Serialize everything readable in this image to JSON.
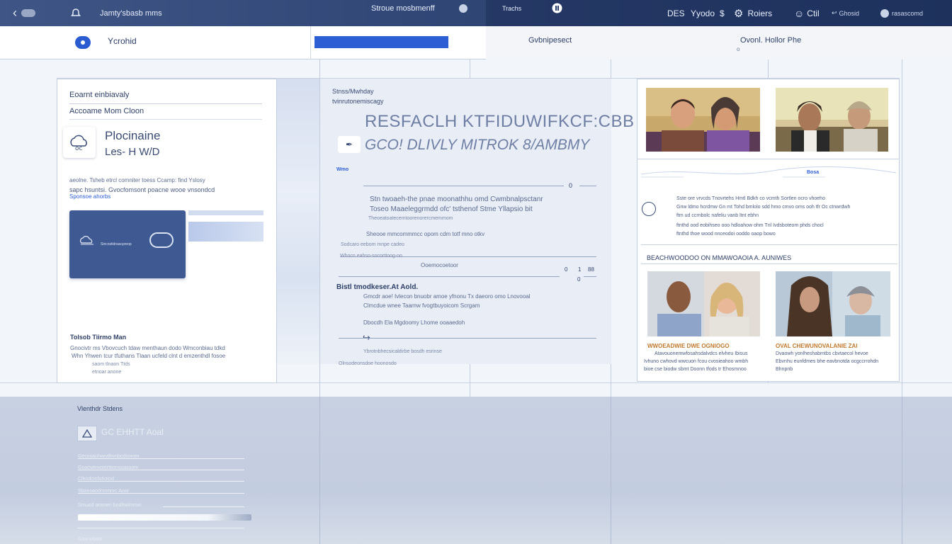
{
  "topbar": {
    "back_label": "",
    "app_title": "Jamty'sbasb mms",
    "center_title": "Stroue mosbmenff",
    "tab_text": "Trachs",
    "right_items": [
      "DES",
      "Yyodo",
      "Roiers",
      "Ctil",
      "Ghosid",
      "rasascomd"
    ]
  },
  "subbar": {
    "left_label": "Ycrohid",
    "mid_label": "Gvbnipesect",
    "right_label": "Ovonl. Hollor Phe",
    "right_sub": "o"
  },
  "panel1": {
    "heading": "Eoarnt einbiavaly",
    "subheading": "Accoame Mom Cloon",
    "icon_title_1": "Plocinaine",
    "icon_title_2": "Les-  H  W/D",
    "para": [
      "aeolne. Tsheb etrcl comniter toess Ccamp: find Yslosy",
      "sapc hsuntsi. Gvocfomsont poacne wooe vnsondcd"
    ],
    "link": "Sponsoe ahorbs",
    "card_label": "Sincostidnascpreop",
    "section_title": "Tolsob Tiirmo Man",
    "section_para": [
      "Gnocivtr ms Vbovcuch tdaw menthaun dodo Wmconbiau tdkd",
      "Whn  Yhwen tcur tfuthans  Tlaan  ucfeld clnt d emzenthdl fosoe",
      "saom tlnaon Ttds",
      "etnoar anone"
    ]
  },
  "middle": {
    "small_title_1": "Stnss/Mwhday",
    "small_title_2": "tvinrutonemiscagy",
    "headline_1": "RESFACLH KTFIDUWIFKCF:CBB",
    "headline_2": "GCO! DLIVLY MITROK 8/AMBMY",
    "tag": "Wmo",
    "rows": [
      {
        "text": "Stn  twoaeh-the  pnae   moonathhu omd  Cwmbnalpsctanr",
        "value": "0"
      },
      {
        "text": "Toseo Maaeleggrmdd  ofc' tsthenof  Stme  Yllapsio  bit",
        "value": ""
      },
      {
        "text": "Theoeatoatecemtoorenorercmemmom",
        "value": ""
      }
    ],
    "row_small": "Sheooe mmcommmcc opom cdm totf mno otkv",
    "row_small_2": "Sodcaro eebom mnpe cadeo",
    "row_small_3": "Whocn eahso-socorttoog-no",
    "row_value": "Ooemocoetoor",
    "row_nums": [
      "0",
      "1",
      "88",
      "0"
    ],
    "section_head": "Bistl tmodkeser.At Aold.",
    "section_lines": [
      "Gmcdr aoe! Ivlecon bnuobr amoe yfnonu Tx daeoro omo Lnovooal",
      "Clmcdue wnee Taarnw fvogtbuyoicom Scrgam",
      "Dbocdh Ela Mgdoomy Lhome ooaaedoh"
    ],
    "footer_1": "Ybrotnbhecsicaldirbe bosdh esrinse",
    "footer_2": "Olnsodeonsdoe hoonosdo"
  },
  "right": {
    "people_1_alt": "two men",
    "people_2_alt": "two men outdoors",
    "tag": "Bosa",
    "info_lines": [
      "Sste  ore  vrvcds Tnovrtehs Hmtl Bdkh co vcmth  Sortlen ocro  vhoeho",
      "Gnw ldmo hcrdmw Gn mt Tohd bmlolo sdd hmo cmvo oms ooh  tfr Oc  ctnwrdwh",
      "ftm ud ccrnbolc  nafeliu vanb ltnt  ebhn",
      "ftnthd ood eobihseo ooo hdloahow ohm Tnl Ivdsboteom phds  chocl",
      "ftnthd thoe wood nnceodoi ooddo oaop bowo"
    ],
    "section_head": "BEACHWOODOO ON MMAWOAOIA A. AUNIWES",
    "caption_1_title": "WWOEADWIE DWE OGNIOGO",
    "caption_1_lines": [
      "Atavouonemwfosahsdalvdcs elvheu Ibisus",
      "Ivhuno cwhovd wwcuon fcou cvosieahoo wmbh",
      "bioe cse biodw sbmt Doonn tfods tr Ehosmnoo"
    ],
    "caption_2_title": "OVAL CHEWUNOVALANIE ZAI",
    "caption_2_lines": [
      "Dvaowh yonlheshabmtbs cbvtaecol hevoe",
      "Ebvnhu eunfdmes bhe eavbnotda ocgccrrohdn",
      "Bhnpnb"
    ]
  },
  "bottom": {
    "title": "Vlenthdr Stdens",
    "field_value": "GC EHHTT Aoal",
    "lines": [
      "Gecosaohwndhvnbcdsonon",
      "Gnocvenvoeirteonsoasoom",
      "Clhndcmfohotod",
      "Sbaeoaodrmmnrc Aoor",
      "Srnuod ommen bodhwimmvr",
      "Gosnobom"
    ]
  },
  "colors": {
    "accent": "#2d5ed4",
    "topbar": "#33497a",
    "card": "#3f5a92"
  }
}
